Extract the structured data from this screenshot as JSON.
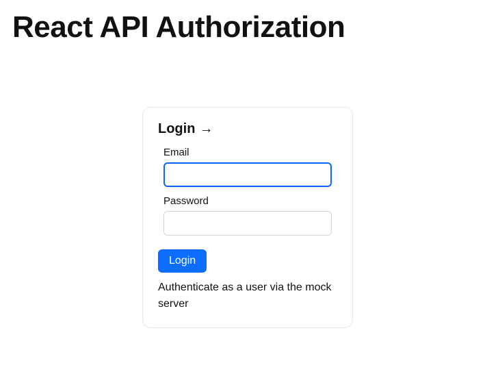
{
  "page": {
    "title": "React API Authorization"
  },
  "card": {
    "title": "Login",
    "arrow_glyph": "→",
    "caption": "Authenticate as a user via the mock server"
  },
  "form": {
    "email": {
      "label": "Email",
      "value": ""
    },
    "password": {
      "label": "Password",
      "value": ""
    },
    "submit_label": "Login"
  }
}
